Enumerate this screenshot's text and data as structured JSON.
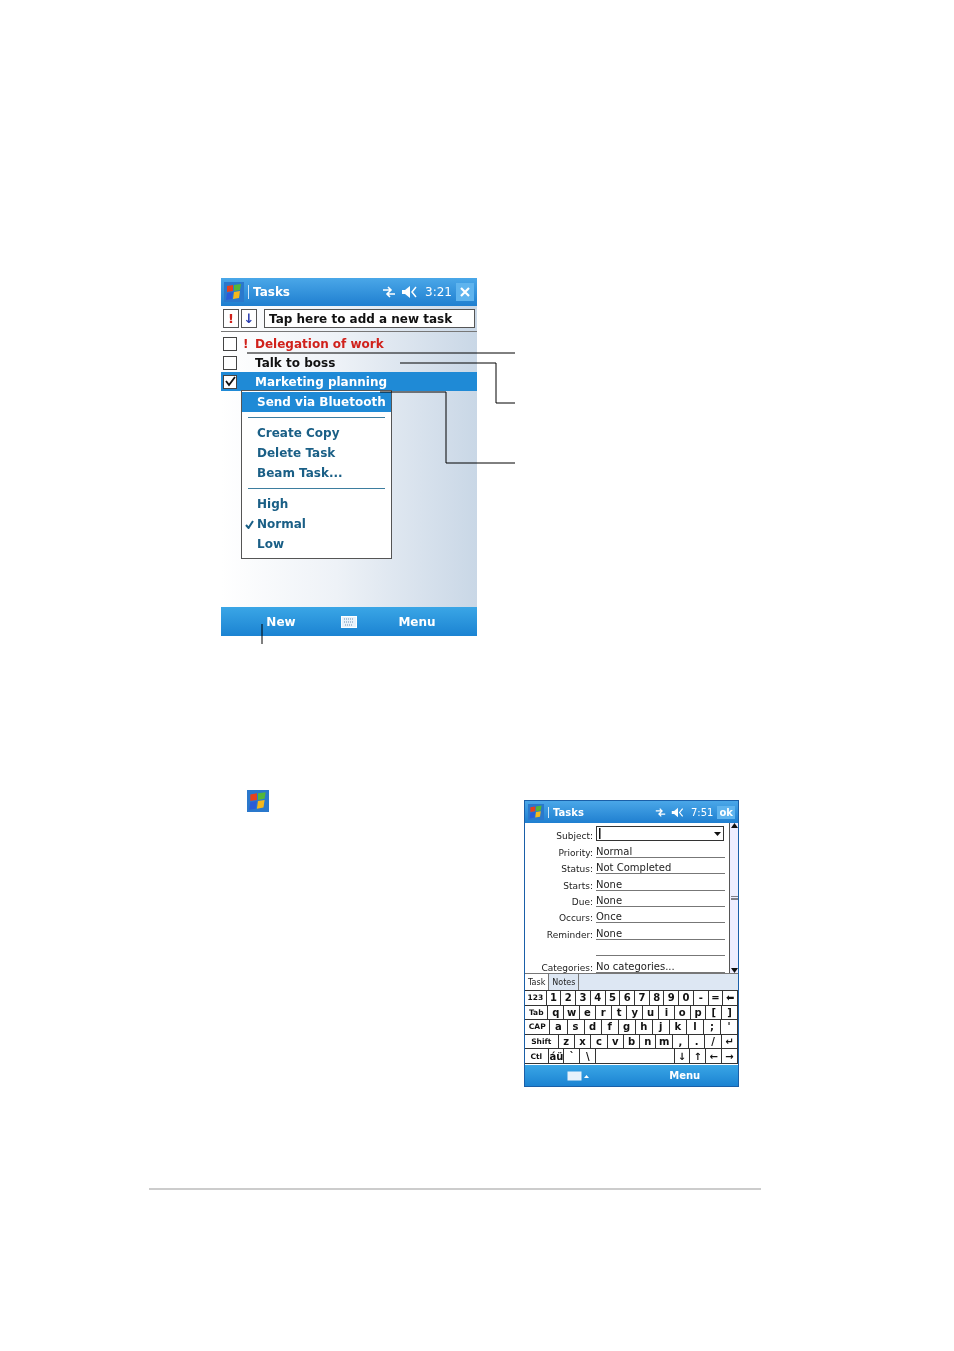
{
  "task_list_screen": {
    "title": "Tasks",
    "time": "3:21",
    "toolbar": {
      "priority_button": "!",
      "sort_button": "↓",
      "new_task_placeholder": "Tap here to add a new task"
    },
    "tasks": [
      {
        "title": "Delegation of work",
        "priority_mark": "!",
        "checked": false,
        "selected": false
      },
      {
        "title": "Talk to boss",
        "checked": false,
        "selected": false
      },
      {
        "title": "Marketing planning",
        "checked": true,
        "selected": true
      }
    ],
    "context_menu": [
      {
        "kind": "item",
        "label": "Send via Bluetooth",
        "highlighted": true,
        "checked": false
      },
      {
        "kind": "separator"
      },
      {
        "kind": "item",
        "label": "Create Copy",
        "highlighted": false,
        "checked": false
      },
      {
        "kind": "item",
        "label": "Delete Task",
        "highlighted": false,
        "checked": false
      },
      {
        "kind": "item",
        "label": "Beam Task...",
        "highlighted": false,
        "checked": false
      },
      {
        "kind": "separator"
      },
      {
        "kind": "item",
        "label": "High",
        "highlighted": false,
        "checked": false
      },
      {
        "kind": "item",
        "label": "Normal",
        "highlighted": false,
        "checked": true
      },
      {
        "kind": "item",
        "label": "Low",
        "highlighted": false,
        "checked": false
      }
    ],
    "bottom_bar": {
      "left": "New",
      "right": "Menu"
    }
  },
  "new_task_screen": {
    "title": "Tasks",
    "time": "7:51",
    "ok_button": "ok",
    "fields": [
      {
        "kind": "dropdown",
        "label": "Subject:"
      },
      {
        "kind": "text",
        "label": "Priority:",
        "value": "Normal"
      },
      {
        "kind": "text",
        "label": "Status:",
        "value": "Not Completed"
      },
      {
        "kind": "text",
        "label": "Starts:",
        "value": "None"
      },
      {
        "kind": "text",
        "label": "Due:",
        "value": "None"
      },
      {
        "kind": "text",
        "label": "Occurs:",
        "value": "Once"
      },
      {
        "kind": "text",
        "label": "Reminder:",
        "value": "None"
      },
      {
        "kind": "blank"
      },
      {
        "kind": "text",
        "label": "Categories:",
        "value": "No categories..."
      }
    ],
    "tabs": [
      {
        "label": "Task",
        "selected": true
      },
      {
        "label": "Notes",
        "selected": false
      }
    ],
    "keyboard": [
      {
        "keys": [
          "123",
          "1",
          "2",
          "3",
          "4",
          "5",
          "6",
          "7",
          "8",
          "9",
          "0",
          "-",
          "=",
          "⬅"
        ]
      },
      {
        "keys": [
          "Tab",
          "q",
          "w",
          "e",
          "r",
          "t",
          "y",
          "u",
          "i",
          "o",
          "p",
          "[",
          "]"
        ]
      },
      {
        "keys": [
          "CAP",
          "a",
          "s",
          "d",
          "f",
          "g",
          "h",
          "j",
          "k",
          "l",
          ";",
          "'"
        ]
      },
      {
        "keys": [
          "Shift",
          "z",
          "x",
          "c",
          "v",
          "b",
          "n",
          "m",
          ",",
          ".",
          "/",
          "↵"
        ]
      },
      {
        "keys": [
          "Ctl",
          "áü",
          "`",
          "\\"
        ],
        "keys_after_space": [
          "↓",
          "↑",
          "←",
          "→"
        ]
      }
    ],
    "bottom_bar": {
      "right": "Menu"
    }
  }
}
